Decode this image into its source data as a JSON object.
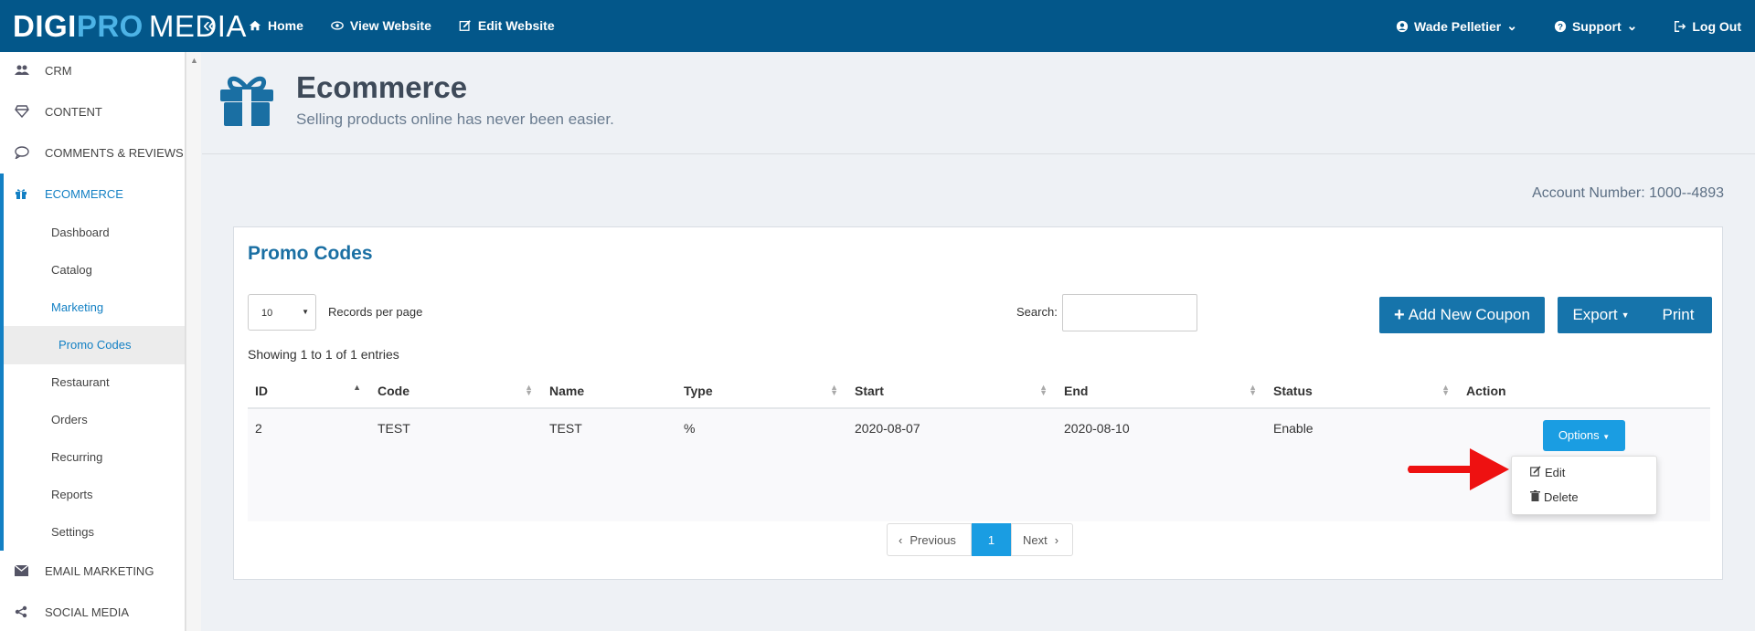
{
  "brand": {
    "part1": "DIGI",
    "part2": "PRO",
    "part3": "MEDIA"
  },
  "topnav": [
    {
      "label": "Home",
      "icon": "home-icon"
    },
    {
      "label": "View Website",
      "icon": "eye-icon"
    },
    {
      "label": "Edit Website",
      "icon": "edit-icon"
    }
  ],
  "user": {
    "name": "Wade Pelletier",
    "support": "Support",
    "logout": "Log Out"
  },
  "sidebar": {
    "items": [
      {
        "label": "CRM",
        "icon": "users-icon"
      },
      {
        "label": "CONTENT",
        "icon": "diamond-icon"
      },
      {
        "label": "COMMENTS & REVIEWS",
        "icon": "comment-icon"
      },
      {
        "label": "ECOMMERCE",
        "icon": "gift-icon"
      },
      {
        "label": "EMAIL MARKETING",
        "icon": "envelope-icon"
      },
      {
        "label": "SOCIAL MEDIA",
        "icon": "share-icon"
      }
    ],
    "sub": [
      "Dashboard",
      "Catalog",
      "Marketing",
      "Restaurant",
      "Orders",
      "Recurring",
      "Reports",
      "Settings"
    ],
    "subsub": "Promo Codes"
  },
  "header": {
    "title": "Ecommerce",
    "subtitle": "Selling products online has never been easier."
  },
  "account": "Account Number: 1000--4893",
  "panel": {
    "title": "Promo Codes",
    "rpp_value": "10",
    "rpp_label": "Records per page",
    "search_label": "Search:",
    "search_value": "",
    "add_label": "Add New Coupon",
    "export_label": "Export",
    "print_label": "Print",
    "showing": "Showing 1 to 1 of 1 entries"
  },
  "table": {
    "columns": [
      "ID",
      "Code",
      "Name",
      "Type",
      "Start",
      "End",
      "Status",
      "Action"
    ],
    "rows": [
      {
        "id": "2",
        "code": "TEST",
        "name": "TEST",
        "type": "%",
        "start": "2020-08-07",
        "end": "2020-08-10",
        "status": "Enable",
        "action": "Options"
      }
    ]
  },
  "dropdown": {
    "edit": "Edit",
    "delete": "Delete"
  },
  "pager": {
    "prev": "Previous",
    "current": "1",
    "next": "Next"
  },
  "colors": {
    "topbar": "#03578a",
    "accent": "#1380c4",
    "button": "#1674ab",
    "options": "#1a9de2",
    "arrow": "#ee1111"
  }
}
